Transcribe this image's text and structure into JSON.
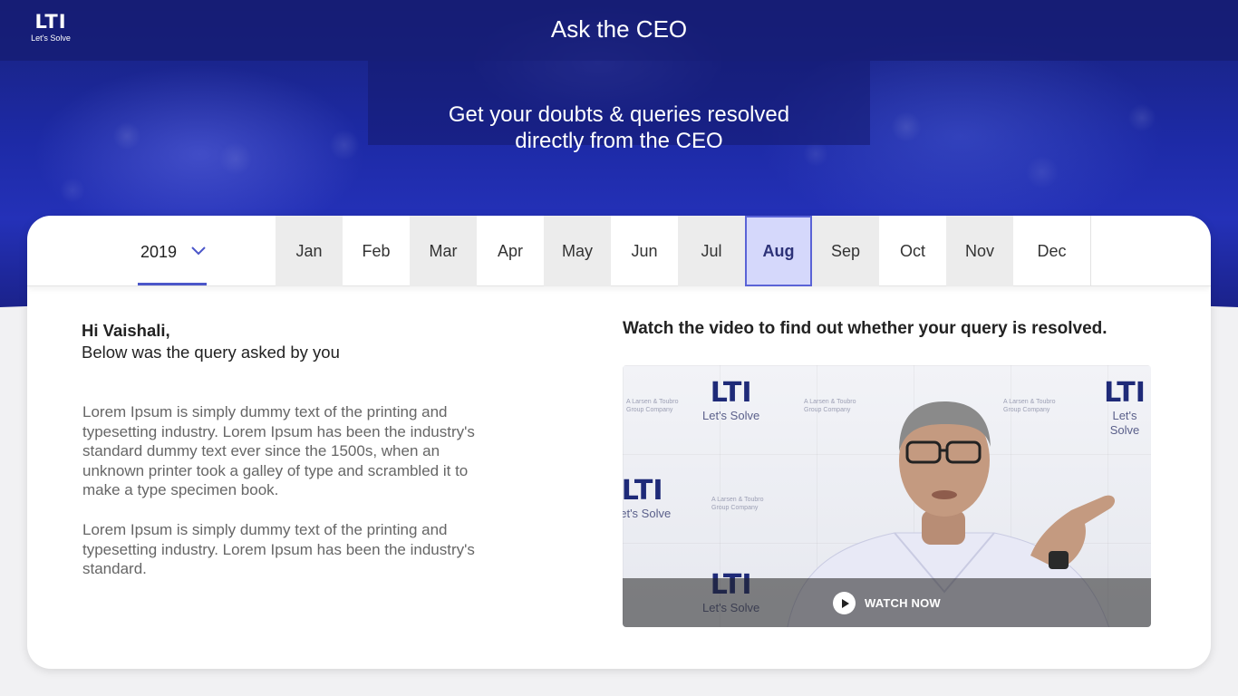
{
  "brand": {
    "logo_mark": "LTI",
    "logo_tagline": "Let's Solve"
  },
  "header": {
    "title": "Ask the CEO"
  },
  "hero": {
    "subtitle_line1": "Get your doubts & queries resolved",
    "subtitle_line2": "directly from the CEO"
  },
  "year_selector": {
    "selected": "2019"
  },
  "months": [
    {
      "label": "Jan",
      "active": false
    },
    {
      "label": "Feb",
      "active": false
    },
    {
      "label": "Mar",
      "active": false
    },
    {
      "label": "Apr",
      "active": false
    },
    {
      "label": "May",
      "active": false
    },
    {
      "label": "Jun",
      "active": false
    },
    {
      "label": "Jul",
      "active": false
    },
    {
      "label": "Aug",
      "active": true
    },
    {
      "label": "Sep",
      "active": false
    },
    {
      "label": "Oct",
      "active": false
    },
    {
      "label": "Nov",
      "active": false
    },
    {
      "label": "Dec",
      "active": false
    }
  ],
  "query": {
    "greeting": "Hi Vaishali,",
    "intro": "Below was the query asked by you",
    "paragraph1": "Lorem Ipsum is simply dummy text of the printing and typesetting industry. Lorem Ipsum has been the industry's standard dummy text ever since the 1500s, when an unknown printer took a galley of type and scrambled it to make a type specimen book.",
    "paragraph2": "Lorem Ipsum is simply dummy text of the printing and typesetting industry. Lorem Ipsum has been the industry's standard."
  },
  "video": {
    "heading": "Watch the video to find out whether your query is resolved.",
    "watch_label": "WATCH NOW",
    "play_icon": "play-icon",
    "backdrop_logo": "LTI",
    "backdrop_tagline": "Let's Solve",
    "backdrop_group_text": "A Larsen & Toubro Group Company"
  },
  "colors": {
    "accent": "#4b56c9",
    "active_month_bg": "#d5d8fb",
    "hero": "#1d2aa6"
  }
}
